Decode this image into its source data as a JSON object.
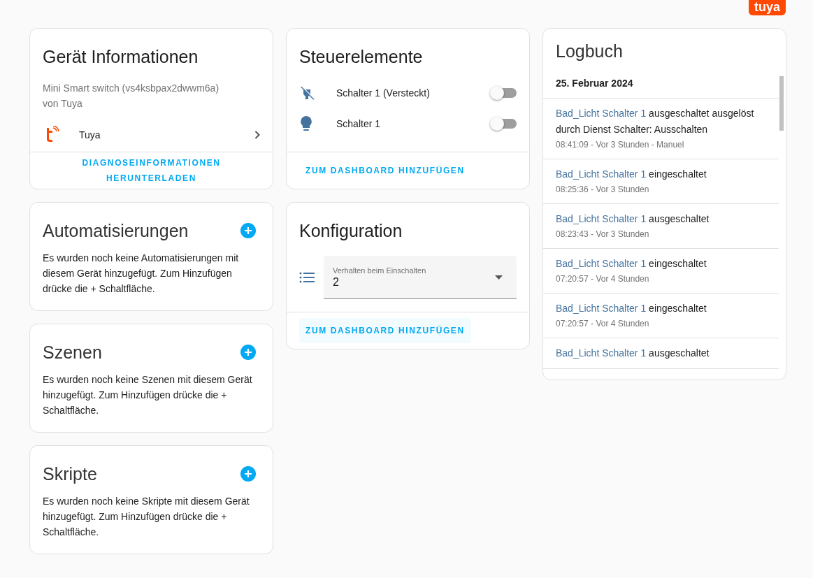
{
  "brand_badge": "tuya",
  "device_info": {
    "title": "Gerät Informationen",
    "model": "Mini Smart switch (vs4ksbpax2dwwm6a)",
    "manufacturer": "von Tuya",
    "integration": "Tuya",
    "action": "DIAGNOSEINFORMATIONEN HERUNTERLADEN"
  },
  "related_cards": [
    {
      "title": "Automatisierungen",
      "text": "Es wurden noch keine Automatisierungen mit diesem Gerät hinzugefügt. Zum Hinzufügen drücke die + Schaltfläche."
    },
    {
      "title": "Szenen",
      "text": "Es wurden noch keine Szenen mit diesem Gerät hinzugefügt. Zum Hinzufügen drücke die + Schaltfläche."
    },
    {
      "title": "Skripte",
      "text": "Es wurden noch keine Skripte mit diesem Gerät hinzugefügt. Zum Hinzufügen drücke die + Schaltfläche."
    }
  ],
  "controls": {
    "title": "Steuerelemente",
    "entities": [
      {
        "name": "Schalter 1 (Versteckt)",
        "on": false
      },
      {
        "name": "Schalter 1",
        "on": false
      }
    ],
    "action": "ZUM DASHBOARD HINZUFÜGEN"
  },
  "configuration": {
    "title": "Konfiguration",
    "select": {
      "label": "Verhalten beim Einschalten",
      "value": "2"
    },
    "action": "ZUM DASHBOARD HINZUFÜGEN"
  },
  "logbook": {
    "title": "Logbuch",
    "date": "25. Februar 2024",
    "entries": [
      {
        "entity": "Bad_Licht Schalter 1",
        "message": "ausgeschaltet ausgelöst durch Dienst Schalter: Ausschalten",
        "meta": "08:41:09 - Vor 3 Stunden - Manuel"
      },
      {
        "entity": "Bad_Licht Schalter 1",
        "message": "eingeschaltet",
        "meta": "08:25:36 - Vor 3 Stunden"
      },
      {
        "entity": "Bad_Licht Schalter 1",
        "message": "ausgeschaltet",
        "meta": "08:23:43 - Vor 3 Stunden"
      },
      {
        "entity": "Bad_Licht Schalter 1",
        "message": "eingeschaltet",
        "meta": "07:20:57 - Vor 4 Stunden"
      },
      {
        "entity": "Bad_Licht Schalter 1",
        "message": "eingeschaltet",
        "meta": "07:20:57 - Vor 4 Stunden"
      },
      {
        "entity": "Bad_Licht Schalter 1",
        "message": "ausgeschaltet"
      }
    ]
  }
}
